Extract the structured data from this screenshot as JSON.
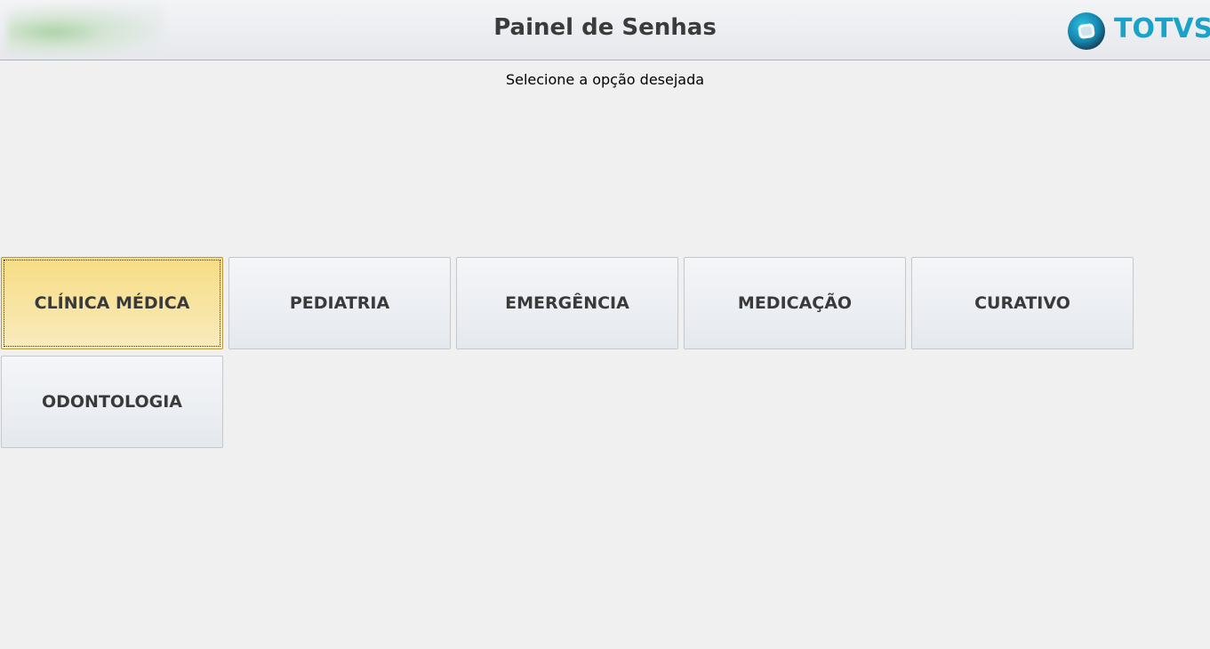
{
  "header": {
    "title": "Painel de Senhas",
    "brand": {
      "name": "TOTVS",
      "icon": "totvs-logo-icon",
      "color": "#1aa3c8"
    }
  },
  "subtitle": "Selecione a opção desejada",
  "options": [
    {
      "label": "CLÍNICA MÉDICA",
      "selected": true
    },
    {
      "label": "PEDIATRIA",
      "selected": false
    },
    {
      "label": "EMERGÊNCIA",
      "selected": false
    },
    {
      "label": "MEDICAÇÃO",
      "selected": false
    },
    {
      "label": "CURATIVO",
      "selected": false
    },
    {
      "label": "ODONTOLOGIA",
      "selected": false
    }
  ],
  "colors": {
    "selected_button": "#f6dd84",
    "button": "#eceef2",
    "background": "#f0f0f0"
  }
}
